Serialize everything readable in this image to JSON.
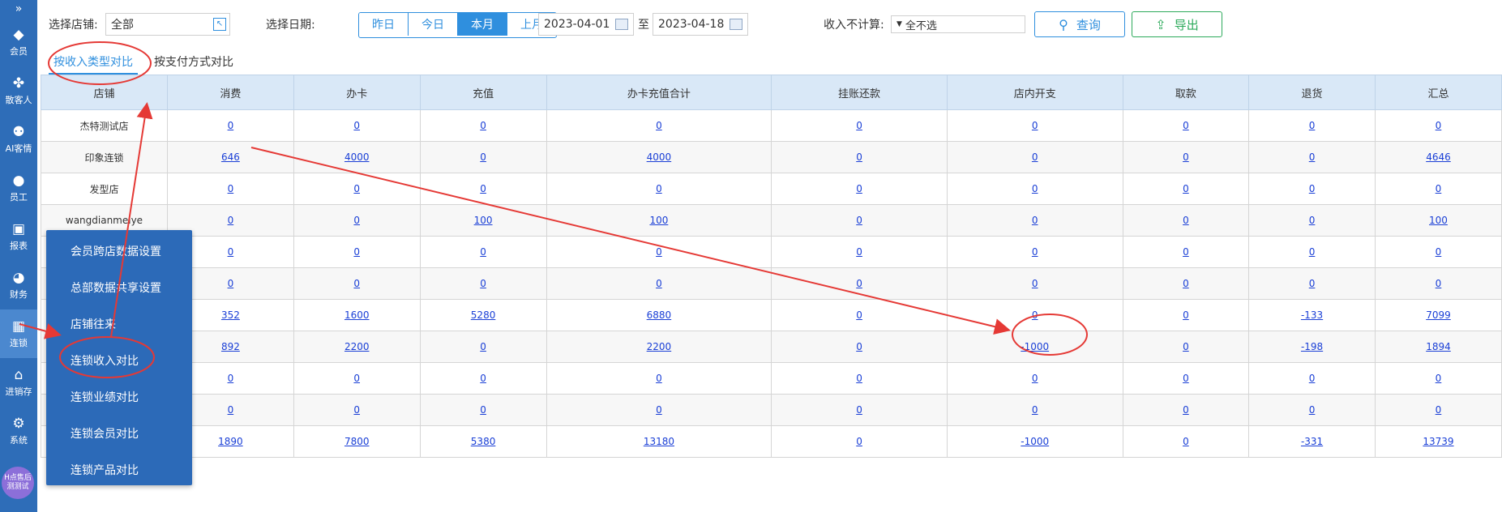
{
  "sidebar": {
    "collapse_glyph": "»",
    "items": [
      {
        "icon": "diamond-icon",
        "glyph": "◆",
        "label": "会员"
      },
      {
        "icon": "clover-icon",
        "glyph": "✤",
        "label": "散客人"
      },
      {
        "icon": "person-gear-icon",
        "glyph": "⚉",
        "label": "AI客情"
      },
      {
        "icon": "person-icon",
        "glyph": "●",
        "label": "员工"
      },
      {
        "icon": "monitor-icon",
        "glyph": "▣",
        "label": "报表"
      },
      {
        "icon": "pie-chart-icon",
        "glyph": "◕",
        "label": "财务"
      },
      {
        "icon": "building-icon",
        "glyph": "▦",
        "label": "连锁"
      },
      {
        "icon": "house-icon",
        "glyph": "⌂",
        "label": "进销存"
      },
      {
        "icon": "gear-icon",
        "glyph": "⚙",
        "label": "系统"
      }
    ],
    "active_index": 6,
    "avatar_text_1": "H点售后",
    "avatar_text_2": "测测试"
  },
  "toolbar": {
    "store_label": "选择店铺:",
    "store_value": "全部",
    "date_label": "选择日期:",
    "date_options": [
      "昨日",
      "今日",
      "本月",
      "上月"
    ],
    "date_selected_index": 2,
    "date_from": "2023-04-01",
    "date_sep": "至",
    "date_to": "2023-04-18",
    "exclude_label": "收入不计算:",
    "exclude_value": "全不选",
    "query_label": "查询",
    "export_label": "导出"
  },
  "tabs": [
    "按收入类型对比",
    "按支付方式对比"
  ],
  "active_tab": 0,
  "table": {
    "columns": [
      "店铺",
      "消费",
      "办卡",
      "充值",
      "办卡充值合计",
      "挂账还款",
      "店内开支",
      "取款",
      "退货",
      "汇总"
    ],
    "rows": [
      [
        "杰特测试店",
        "0",
        "0",
        "0",
        "0",
        "0",
        "0",
        "0",
        "0",
        "0"
      ],
      [
        "印象连锁",
        "646",
        "4000",
        "0",
        "4000",
        "0",
        "0",
        "0",
        "0",
        "4646"
      ],
      [
        "发型店",
        "0",
        "0",
        "0",
        "0",
        "0",
        "0",
        "0",
        "0",
        "0"
      ],
      [
        "wangdianmeiye",
        "0",
        "0",
        "100",
        "100",
        "0",
        "0",
        "0",
        "0",
        "100"
      ],
      [
        "",
        "0",
        "0",
        "0",
        "0",
        "0",
        "0",
        "0",
        "0",
        "0"
      ],
      [
        "",
        "0",
        "0",
        "0",
        "0",
        "0",
        "0",
        "0",
        "0",
        "0"
      ],
      [
        "",
        "352",
        "1600",
        "5280",
        "6880",
        "0",
        "0",
        "0",
        "-133",
        "7099"
      ],
      [
        "",
        "892",
        "2200",
        "0",
        "2200",
        "0",
        "-1000",
        "0",
        "-198",
        "1894"
      ],
      [
        "",
        "0",
        "0",
        "0",
        "0",
        "0",
        "0",
        "0",
        "0",
        "0"
      ],
      [
        "",
        "0",
        "0",
        "0",
        "0",
        "0",
        "0",
        "0",
        "0",
        "0"
      ],
      [
        "",
        "1890",
        "7800",
        "5380",
        "13180",
        "0",
        "-1000",
        "0",
        "-331",
        "13739"
      ]
    ]
  },
  "menu": {
    "items": [
      "会员跨店数据设置",
      "总部数据共享设置",
      "店铺往来",
      "连锁收入对比",
      "连锁业绩对比",
      "连锁会员对比",
      "连锁产品对比"
    ]
  },
  "colors": {
    "sidebar_bg": "#2e6db8",
    "accent": "#2f8fde",
    "export_green": "#2daa5b",
    "link": "#1a3fd6",
    "annotation_red": "#e53935"
  }
}
